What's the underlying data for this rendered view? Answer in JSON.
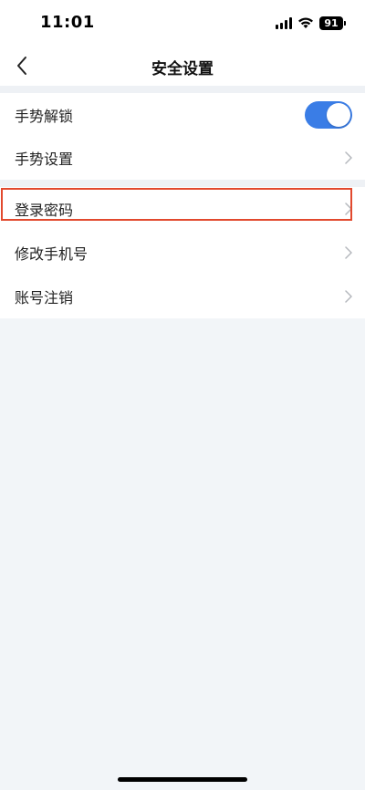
{
  "status_bar": {
    "time": "11:01",
    "battery": "91",
    "icons": [
      "signal-icon",
      "wifi-icon",
      "battery-icon"
    ]
  },
  "header": {
    "title": "安全设置",
    "back_icon": "chevron-left-icon"
  },
  "settings": {
    "items": [
      {
        "label": "手势解锁",
        "control": "toggle",
        "enabled": true
      },
      {
        "label": "手势设置",
        "control": "chevron"
      },
      {
        "label": "登录密码",
        "control": "chevron",
        "highlighted": true
      },
      {
        "label": "修改手机号",
        "control": "chevron"
      },
      {
        "label": "账号注销",
        "control": "chevron"
      }
    ]
  },
  "colors": {
    "accent": "#3a7de6",
    "highlight": "#e2492e",
    "background": "#f2f5f8"
  }
}
